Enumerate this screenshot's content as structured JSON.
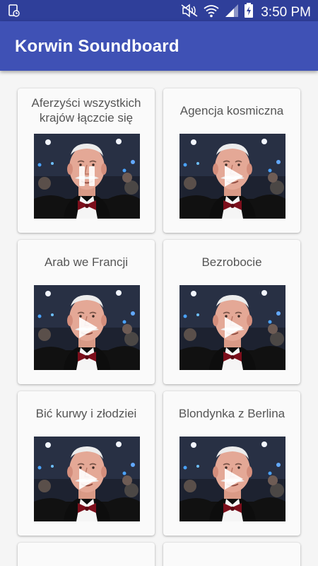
{
  "status_bar": {
    "time": "3:50 PM",
    "icons": [
      "sim-card-icon",
      "mute-icon",
      "wifi-icon",
      "signal-icon",
      "battery-charging-icon"
    ]
  },
  "app_bar": {
    "title": "Korwin Soundboard"
  },
  "colors": {
    "primary": "#3f51b5",
    "primary_dark": "#2f3f9a",
    "card": "#fafafa",
    "background": "#f5f5f5"
  },
  "sounds": [
    {
      "title": "Aferzyści wszystkich krajów łączcie się",
      "state": "playing",
      "overlay_icon": "pause-icon"
    },
    {
      "title": "Agencja kosmiczna",
      "state": "stopped",
      "overlay_icon": "play-icon"
    },
    {
      "title": "Arab we Francji",
      "state": "stopped",
      "overlay_icon": "play-icon"
    },
    {
      "title": "Bezrobocie",
      "state": "stopped",
      "overlay_icon": "play-icon"
    },
    {
      "title": "Bić kurwy i złodziei",
      "state": "stopped",
      "overlay_icon": "play-icon"
    },
    {
      "title": "Blondynka z Berlina",
      "state": "stopped",
      "overlay_icon": "play-icon"
    }
  ]
}
